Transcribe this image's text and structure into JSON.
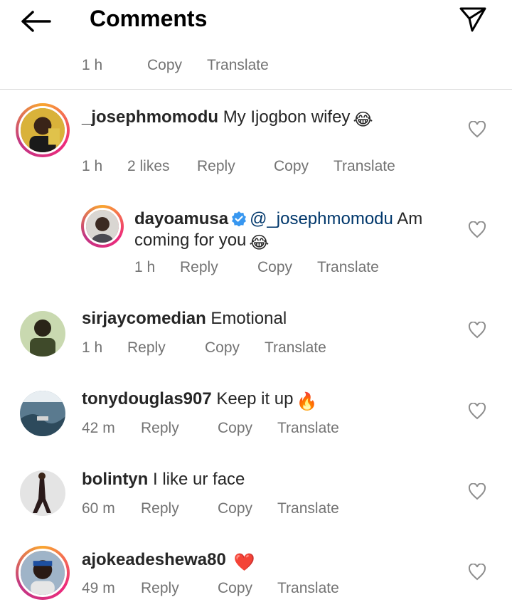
{
  "header": {
    "title": "Comments"
  },
  "top_meta": {
    "time": "1 h",
    "copy": "Copy",
    "translate": "Translate"
  },
  "comments": [
    {
      "username": "_josephmomodu",
      "text": "My Ijogbon wifey",
      "emoji": "😂",
      "time": "1 h",
      "likes": "2 likes",
      "reply": "Reply",
      "copy": "Copy",
      "translate": "Translate"
    },
    {
      "username": "dayoamusa",
      "mention": "@_josephmomodu",
      "text_line1": "Am",
      "text_line2": "coming for you",
      "emoji": "😂",
      "time": "1 h",
      "reply": "Reply",
      "copy": "Copy",
      "translate": "Translate"
    },
    {
      "username": "sirjaycomedian",
      "text": "Emotional",
      "time": "1 h",
      "reply": "Reply",
      "copy": "Copy",
      "translate": "Translate"
    },
    {
      "username": "tonydouglas907",
      "text": "Keep it up",
      "emoji": "🔥",
      "time": "42 m",
      "reply": "Reply",
      "copy": "Copy",
      "translate": "Translate"
    },
    {
      "username": "bolintyn",
      "text": "I like ur face",
      "time": "60 m",
      "reply": "Reply",
      "copy": "Copy",
      "translate": "Translate"
    },
    {
      "username": "ajokeadeshewa80",
      "text": "",
      "emoji": "❤️",
      "time": "49 m",
      "reply": "Reply",
      "copy": "Copy",
      "translate": "Translate"
    }
  ],
  "colors": {
    "meta": "#737373",
    "mention": "#00376b",
    "verified": "#3897f0",
    "divider": "#dbdbdb"
  }
}
